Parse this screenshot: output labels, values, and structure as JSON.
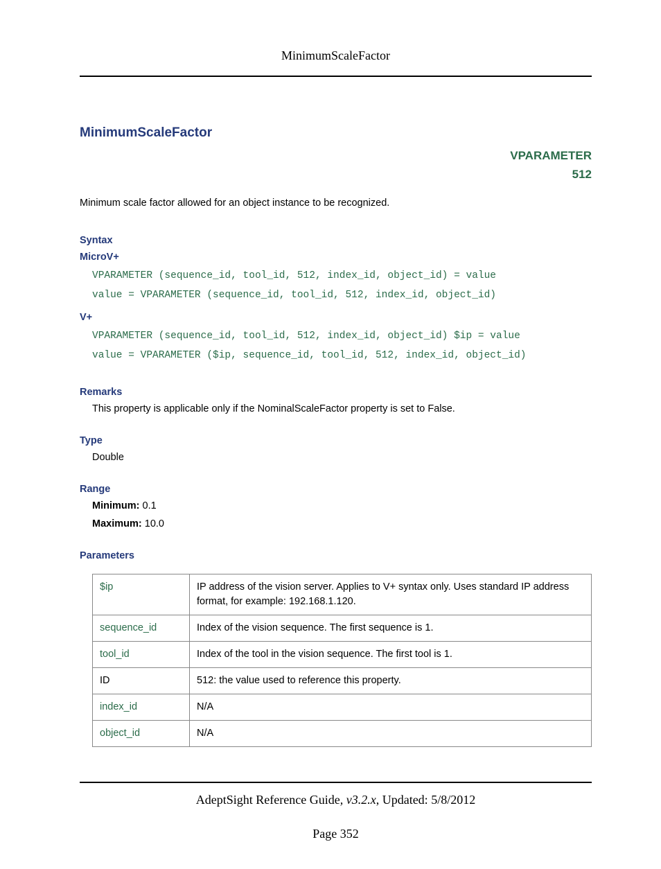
{
  "header": {
    "running_title": "MinimumScaleFactor"
  },
  "title": "MinimumScaleFactor",
  "badge": {
    "line1": "VPARAMETER",
    "line2": "512"
  },
  "intro": "Minimum scale factor allowed for an object instance to be recognized.",
  "sections": {
    "syntax": {
      "heading": "Syntax",
      "microv": {
        "heading": "MicroV+",
        "code": "VPARAMETER (sequence_id, tool_id, 512, index_id, object_id) = value\nvalue = VPARAMETER (sequence_id, tool_id, 512, index_id, object_id)"
      },
      "vplus": {
        "heading": "V+",
        "code": "VPARAMETER (sequence_id, tool_id, 512, index_id, object_id) $ip = value\nvalue = VPARAMETER ($ip, sequence_id, tool_id, 512, index_id, object_id)"
      }
    },
    "remarks": {
      "heading": "Remarks",
      "text": "This property is applicable only if the NominalScaleFactor property is set to False."
    },
    "type": {
      "heading": "Type",
      "text": "Double"
    },
    "range": {
      "heading": "Range",
      "min_label": "Minimum:",
      "min_value": "0.1",
      "max_label": "Maximum:",
      "max_value": "10.0"
    },
    "parameters": {
      "heading": "Parameters",
      "rows": [
        {
          "name": "$ip",
          "plain": false,
          "desc": "IP address of the vision server. Applies to V+ syntax only. Uses standard IP address format, for example: 192.168.1.120."
        },
        {
          "name": "sequence_id",
          "plain": false,
          "desc": "Index of the vision sequence. The first sequence is 1."
        },
        {
          "name": "tool_id",
          "plain": false,
          "desc": "Index of the tool in the vision sequence. The first tool is 1."
        },
        {
          "name": "ID",
          "plain": true,
          "desc": "512: the value used to reference this property."
        },
        {
          "name": "index_id",
          "plain": false,
          "desc": "N/A"
        },
        {
          "name": "object_id",
          "plain": false,
          "desc": "N/A"
        }
      ]
    }
  },
  "footer": {
    "doc": "AdeptSight Reference Guide",
    "version": "v3.2.x",
    "updated_label": "Updated:",
    "updated_value": "5/8/2012",
    "page_label": "Page",
    "page_number": "352"
  }
}
